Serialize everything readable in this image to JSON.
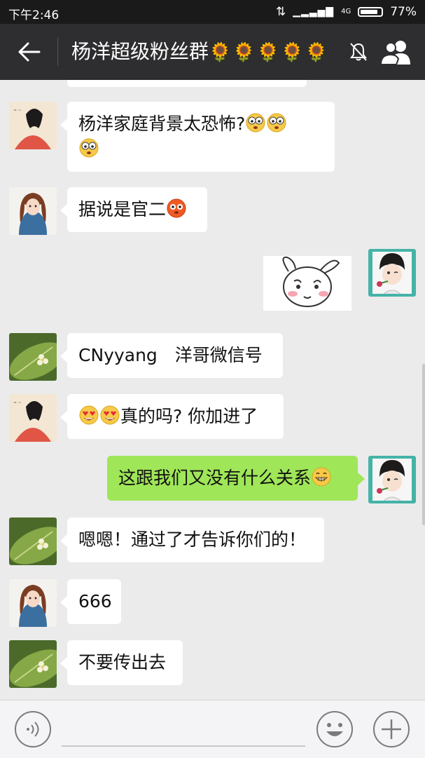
{
  "status_bar": {
    "time": "下午2:46",
    "battery": "77%",
    "battery_level": 0.77,
    "network": "4G"
  },
  "header": {
    "title": "杨洋超级粉丝群",
    "title_emoji": "🌻🌻🌻🌻🌻",
    "icons": [
      "back-arrow-icon",
      "mute-icon",
      "group-members-icon"
    ]
  },
  "messages": [
    {
      "sender": "other",
      "avatar": "girl-red-dress-avatar",
      "text": "杨洋家庭背景太恐怖?",
      "emoji": [
        "shocked-emoji",
        "shocked-emoji",
        "shocked-emoji"
      ]
    },
    {
      "sender": "other",
      "avatar": "girl-long-hair-avatar",
      "text": "据说是官二",
      "emoji": [
        "blushing-emoji"
      ]
    },
    {
      "sender": "self",
      "avatar": "boy-rose-avatar",
      "sticker": "rabbit-sticker"
    },
    {
      "sender": "other",
      "avatar": "flower-leaf-avatar",
      "text": "CNyyang　洋哥微信号"
    },
    {
      "sender": "other",
      "avatar": "girl-red-dress-avatar",
      "lead_emoji": [
        "heart-eyes-emoji",
        "heart-eyes-emoji"
      ],
      "text": "真的吗? 你加进了"
    },
    {
      "sender": "self",
      "avatar": "boy-rose-avatar",
      "text": "这跟我们又没有什么关系",
      "emoji": [
        "grin-emoji"
      ]
    },
    {
      "sender": "other",
      "avatar": "flower-leaf-avatar",
      "text": "嗯嗯！通过了才告诉你们的！"
    },
    {
      "sender": "other",
      "avatar": "girl-long-hair-avatar",
      "text": "666"
    },
    {
      "sender": "other",
      "avatar": "flower-leaf-avatar",
      "text": "不要传出去"
    }
  ],
  "input_bar": {
    "text_value": "",
    "icons": [
      "voice-icon",
      "emoji-icon",
      "plus-icon"
    ]
  },
  "colors": {
    "header_bg": "#2e2e30",
    "status_bg": "#1a1a1a",
    "chat_bg": "#ebebeb",
    "self_bubble": "#9fe658",
    "other_bubble": "#ffffff"
  }
}
